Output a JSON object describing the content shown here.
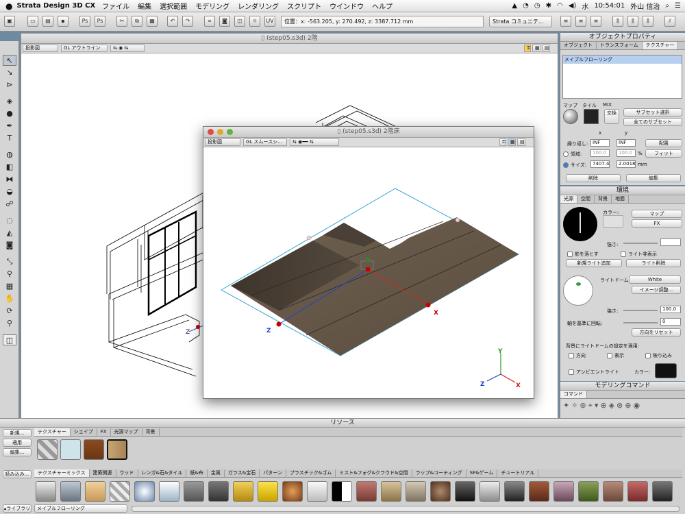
{
  "menubar": {
    "app_name": "Strata Design 3D CX",
    "items": [
      "ファイル",
      "編集",
      "選択範囲",
      "モデリング",
      "レンダリング",
      "スクリプト",
      "ウインドウ",
      "ヘルプ"
    ],
    "day": "水",
    "time": "10:54:01",
    "user": "外山 信治"
  },
  "toolbar": {
    "coordinates": "位置：x: -563.205, y: 270.492, z: 3387.712 mm",
    "community": "Strata コミュニテ..."
  },
  "main_window": {
    "title": "(step05.s3d) 2階",
    "view_popup": "投影図",
    "render_popup": "GL アウトライン"
  },
  "sub_window": {
    "title": "(step05.s3d) 2階床",
    "view_popup": "投影図",
    "render_popup": "GL スムースシ..."
  },
  "axes": {
    "x": "X",
    "y": "Y",
    "z": "Z"
  },
  "object_properties": {
    "title": "オブジェクトプロパティ",
    "tabs": [
      "オブジェクト",
      "トランスフォーム",
      "テクスチャー"
    ],
    "texture_list": [
      "メイプルフローリング"
    ],
    "map_label": "マップ",
    "tile_label": "タイル",
    "mix_label": "MIX",
    "swap_label": "交換",
    "subset_select": "サブセット選択",
    "all_subsets": "全てのサブセット",
    "x_header": "x",
    "y_header": "y",
    "repeat_label": "繰り返し:",
    "repeat_x": "INF",
    "repeat_y": "INF",
    "place_button": "配置",
    "area_label": "領域:",
    "area_x": "100.0",
    "area_y": "100.0",
    "percent": "%",
    "fit_button": "フィット",
    "size_label": "サイズ:",
    "size_x": "7407.4",
    "size_y": "2.0018",
    "size_unit": "mm",
    "delete_button": "削除",
    "edit_button": "編集"
  },
  "environment": {
    "title": "環境",
    "tabs": [
      "光源",
      "空間",
      "背景",
      "地面"
    ],
    "color_label": "カラー:",
    "map_select": "マップ",
    "fx_select": "FX",
    "intensity_label": "強さ:",
    "cast_shadow": "影を落とす",
    "hide_light": "ライト非表示",
    "add_light": "新規ライト追加",
    "delete_light": "ライト削除",
    "light_dome_label": "ライトドーム:",
    "light_dome_value": "White",
    "image_adjust": "イメージ調整...",
    "intensity2_label": "強さ:",
    "intensity2_value": "100.0",
    "rotate_label": "軸を基準に回転:",
    "rotate_value": "0",
    "reset_direction": "方向をリセット",
    "apply_dome_label": "背景にライトドームの設定を適用:",
    "direction": "方向",
    "display": "表示",
    "reflection": "映り込み",
    "ambient_light": "アンビエントライト",
    "color2_label": "カラー:"
  },
  "modeling": {
    "title": "モデリングコマンド",
    "tab": "コマンド"
  },
  "resources": {
    "title": "リソース",
    "new_button": "新規...",
    "apply_button": "適用",
    "edit_button": "編集...",
    "tabs": [
      "テクスチャー",
      "シェイプ",
      "FX",
      "光源マップ",
      "背景"
    ],
    "load_button": "読み込み...",
    "categories": [
      "テクスチャーミックス",
      "建築関連",
      "ウッド",
      "レンガ&石&タイル",
      "紙&布",
      "金属",
      "ガラス&宝石",
      "パターン",
      "プラスチック&ゴム",
      "ミスト&フォグ&クラウド&空間",
      "ラップ&コーティング",
      "SF&ゲーム",
      "チュートリアル"
    ],
    "library_label": "▴ライブラリ",
    "selected_texture": "メイプルフローリング"
  }
}
